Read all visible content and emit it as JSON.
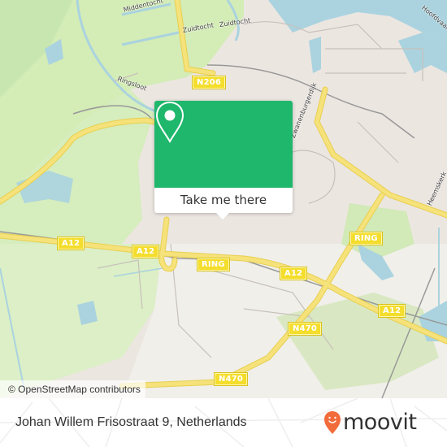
{
  "map": {
    "attribution": "© OpenStreetMap contributors",
    "road_shields": [
      {
        "label": "N206"
      },
      {
        "label": "A12"
      },
      {
        "label": "A12"
      },
      {
        "label": "RING"
      },
      {
        "label": "RING"
      },
      {
        "label": "A12"
      },
      {
        "label": "A12"
      },
      {
        "label": "N470"
      },
      {
        "label": "N470"
      }
    ],
    "street_labels": [
      {
        "label": "Middentocht"
      },
      {
        "label": "Zuidtocht"
      },
      {
        "label": "Zuidtocht"
      },
      {
        "label": "Ringsloot"
      },
      {
        "label": "Zwanenburgerdijk"
      },
      {
        "label": "Heemskerk"
      },
      {
        "label": "Hoofdvaart"
      }
    ],
    "colors": {
      "urban": "#ece6e1",
      "grass": "#cfeaae",
      "water": "#aad3df",
      "highway": "#f6e27a",
      "shield": "#f4dd2c"
    }
  },
  "popup": {
    "icon": "location-pin-icon",
    "button_label": "Take me there",
    "accent_color": "#1eb76b"
  },
  "footer": {
    "address": "Johan Willem Frisostraat 9, Netherlands",
    "brand": "moovit",
    "brand_color": "#f26b3a"
  }
}
